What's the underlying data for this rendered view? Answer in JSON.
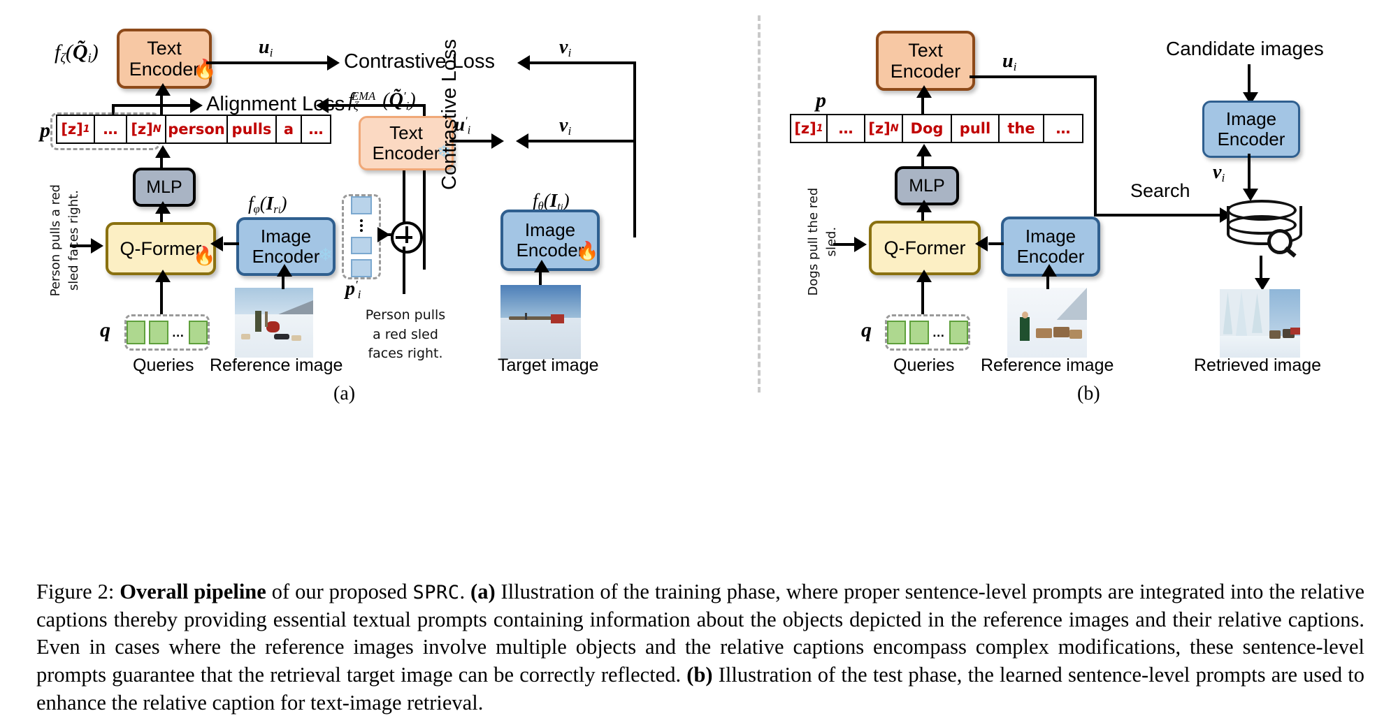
{
  "figure": {
    "number": "Figure 2:",
    "bold_lead": "Overall pipeline",
    "after_lead": " of our proposed ",
    "method_name": "SPRC",
    "part_a_tag": "(a)",
    "part_a_text": " Illustration of the training phase, where proper sentence-level prompts are integrated into the relative captions thereby providing essential textual prompts containing information about the objects depicted in the reference images and their relative captions. Even in cases where the reference images involve multiple objects and the relative captions encompass complex modifications, these sentence-level prompts guarantee that the retrieval target image can be correctly reflected. ",
    "part_b_tag": "(b)",
    "part_b_text": " Illustration of the test phase, the learned sentence-level prompts are used to enhance the relative caption for text-image retrieval."
  },
  "panel_labels": {
    "a": "(a)",
    "b": "(b)"
  },
  "panel_a": {
    "text_encoder": {
      "line1": "Text",
      "line2": "Encoder",
      "state_icon": "fire-icon",
      "state": "🔥"
    },
    "text_encoder_ema": {
      "line1": "Text",
      "line2": "Encoder",
      "state_icon": "snowflake-icon",
      "state": "❄"
    },
    "image_encoder_ref": {
      "line1": "Image",
      "line2": "Encoder",
      "state_icon": "snowflake-icon",
      "state": "❄"
    },
    "image_encoder_tgt": {
      "line1": "Image",
      "line2": "Encoder",
      "state_icon": "fire-icon",
      "state": "🔥"
    },
    "mlp": "MLP",
    "qformer": {
      "label": "Q-Former",
      "state_icon": "fire-icon",
      "state": "🔥"
    },
    "math": {
      "f_zeta_Q": "f",
      "f_zeta_Q_sub": "ζ",
      "f_zeta_Q_arg": "(Q̃i)",
      "f_ema": "f",
      "f_ema_sub": "ζ",
      "f_ema_sup": "EMA",
      "f_ema_arg": "(Q̃′i)",
      "f_phi": "f",
      "f_phi_sub": "φ",
      "f_phi_arg": "(Iri)",
      "f_theta": "f",
      "f_theta_sub": "θ",
      "f_theta_arg": "(Iti)",
      "p": "p",
      "p_prime": "p′i",
      "q": "q",
      "u_i": "ui",
      "u_i_prime": "u′i",
      "v_i_top": "vi",
      "v_i_mid": "vi"
    },
    "losses": {
      "contrastive_top": "Contrastive Loss",
      "alignment": "Alignment Loss",
      "contrastive_right": "Contrastive Loss"
    },
    "tokens": [
      "[z]1",
      "…",
      "[z]N",
      "person",
      "pulls",
      "a",
      "…"
    ],
    "token_subs": [
      "1",
      "",
      "N",
      "",
      "",
      "",
      ""
    ],
    "relative_caption": [
      "Person pulls",
      "a red sled",
      "faces right."
    ],
    "relative_caption_side": [
      "Person pulls",
      "a red sled",
      "faces right."
    ],
    "bottom_labels": {
      "queries": "Queries",
      "reference_image": "Reference image",
      "target_image": "Target image"
    }
  },
  "panel_b": {
    "text_encoder": {
      "line1": "Text",
      "line2": "Encoder"
    },
    "image_encoder_ref": {
      "line1": "Image",
      "line2": "Encoder"
    },
    "image_encoder_cand": {
      "line1": "Image",
      "line2": "Encoder"
    },
    "mlp": "MLP",
    "qformer": {
      "label": "Q-Former"
    },
    "math": {
      "p": "p",
      "q": "q",
      "u_i": "ui",
      "v_i": "vi"
    },
    "tokens": [
      "[z]1",
      "…",
      "[z]N",
      "Dog",
      "pull",
      "the",
      "…"
    ],
    "relative_caption": [
      "Dogs pull",
      "the red",
      "sled."
    ],
    "candidate_images": "Candidate images",
    "search": "Search",
    "bottom_labels": {
      "queries": "Queries",
      "reference_image": "Reference image",
      "retrieved_image": "Retrieved image"
    }
  },
  "colors": {
    "text_encoder_fill": "#f7c8a4",
    "text_encoder_border": "#8d4a1a",
    "text_encoder_ema_fill": "#fbd9c2",
    "image_encoder_fill": "#a3c5e4",
    "image_encoder_border": "#2f5f8f",
    "mlp_fill": "#a9b4c4",
    "qformer_fill": "#fcefc4",
    "qformer_border": "#8a7110",
    "token_text": "#c00000",
    "query_chip": "#aed88f",
    "prompt_chip": "#b9d3ea"
  }
}
